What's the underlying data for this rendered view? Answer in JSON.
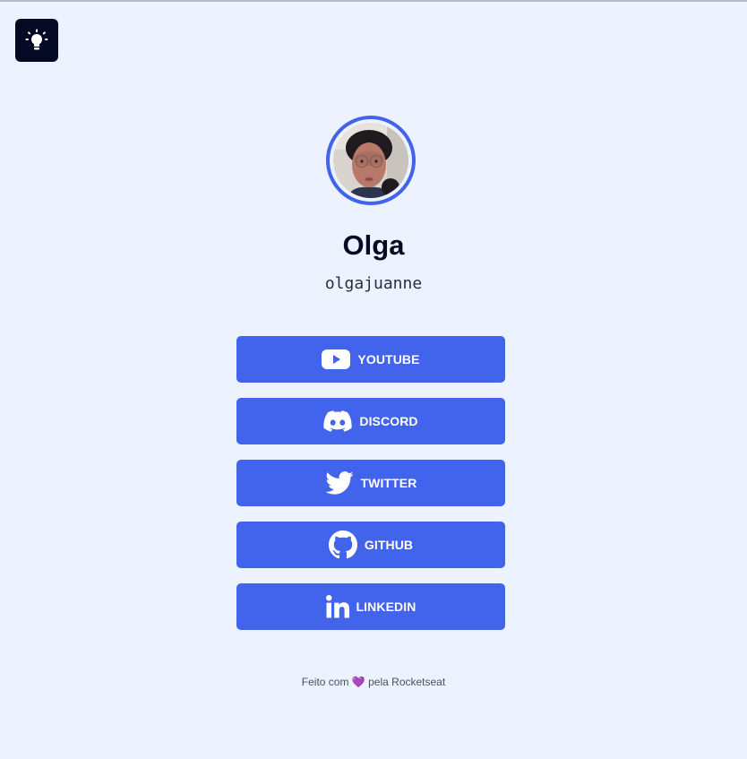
{
  "theme_toggle": {
    "icon": "lightbulb-icon"
  },
  "profile": {
    "avatar_ring_color": "#4263EB",
    "name": "Olga",
    "username": "olgajuanne"
  },
  "links": [
    {
      "label": "YOUTUBE",
      "icon": "youtube-icon"
    },
    {
      "label": "DISCORD",
      "icon": "discord-icon"
    },
    {
      "label": "TWITTER",
      "icon": "twitter-icon"
    },
    {
      "label": "GITHUB",
      "icon": "github-icon"
    },
    {
      "label": "LINKEDIN",
      "icon": "linkedin-icon"
    }
  ],
  "footer": {
    "prefix": "Feito com",
    "heart": "💜",
    "suffix": "pela Rocketseat"
  },
  "colors": {
    "background": "#EDF2FF",
    "button": "#4263EB",
    "dark": "#050A24"
  }
}
